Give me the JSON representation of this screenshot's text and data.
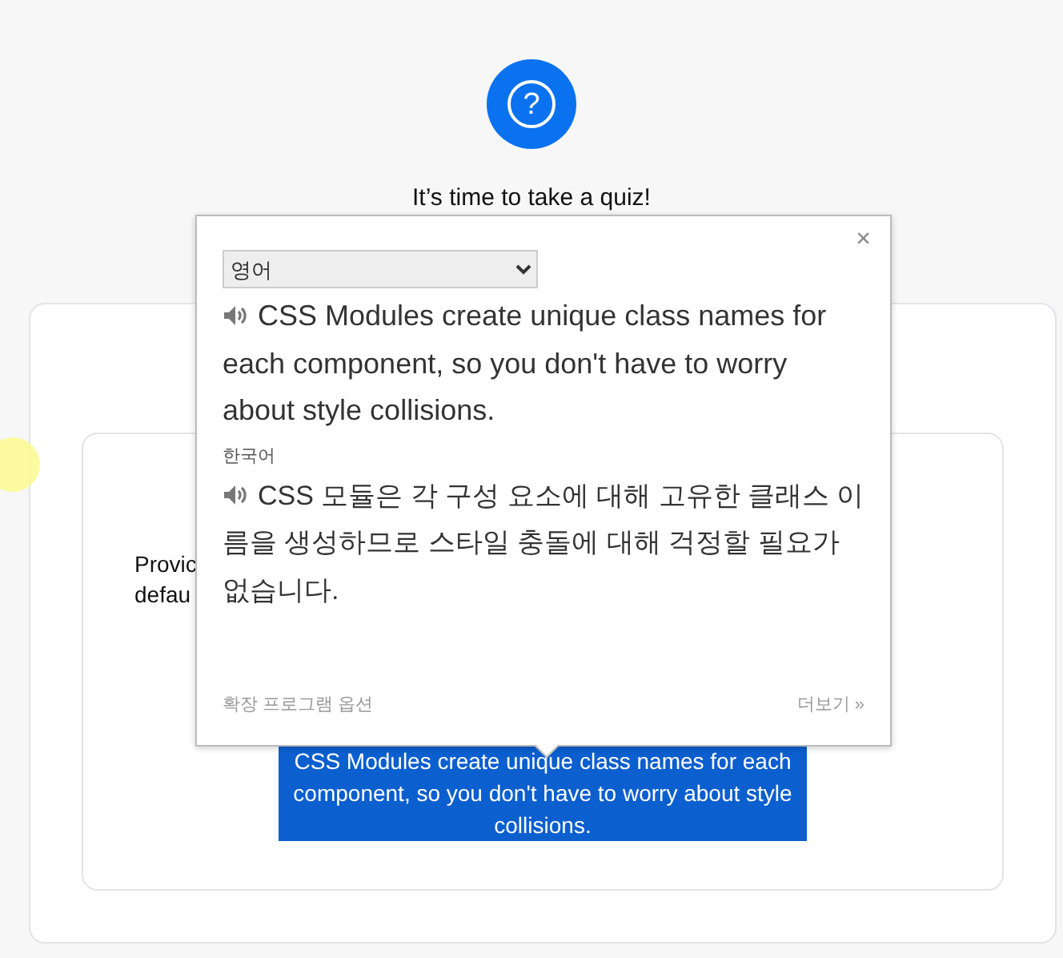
{
  "header": {
    "icon": "?",
    "title": "It’s time to take a quiz!"
  },
  "card": {
    "partial_lines": [
      "Provic",
      "defau"
    ],
    "selected_text": "CSS Modules create unique class names for each component, so you don't have to worry about style collisions."
  },
  "popup": {
    "close": "×",
    "source_language": "영어",
    "source_text": "CSS Modules create unique class names for each component, so you don't have to worry about style collisions.",
    "target_language": "한국어",
    "target_text": "CSS 모듈은 각 구성 요소에 대해 고유한 클래스 이름을 생성하므로 스타일 충돌에 대해 걱정할 필요가 없습니다.",
    "options_link": "확장 프로그램 옵션",
    "more_link": "더보기 »"
  }
}
